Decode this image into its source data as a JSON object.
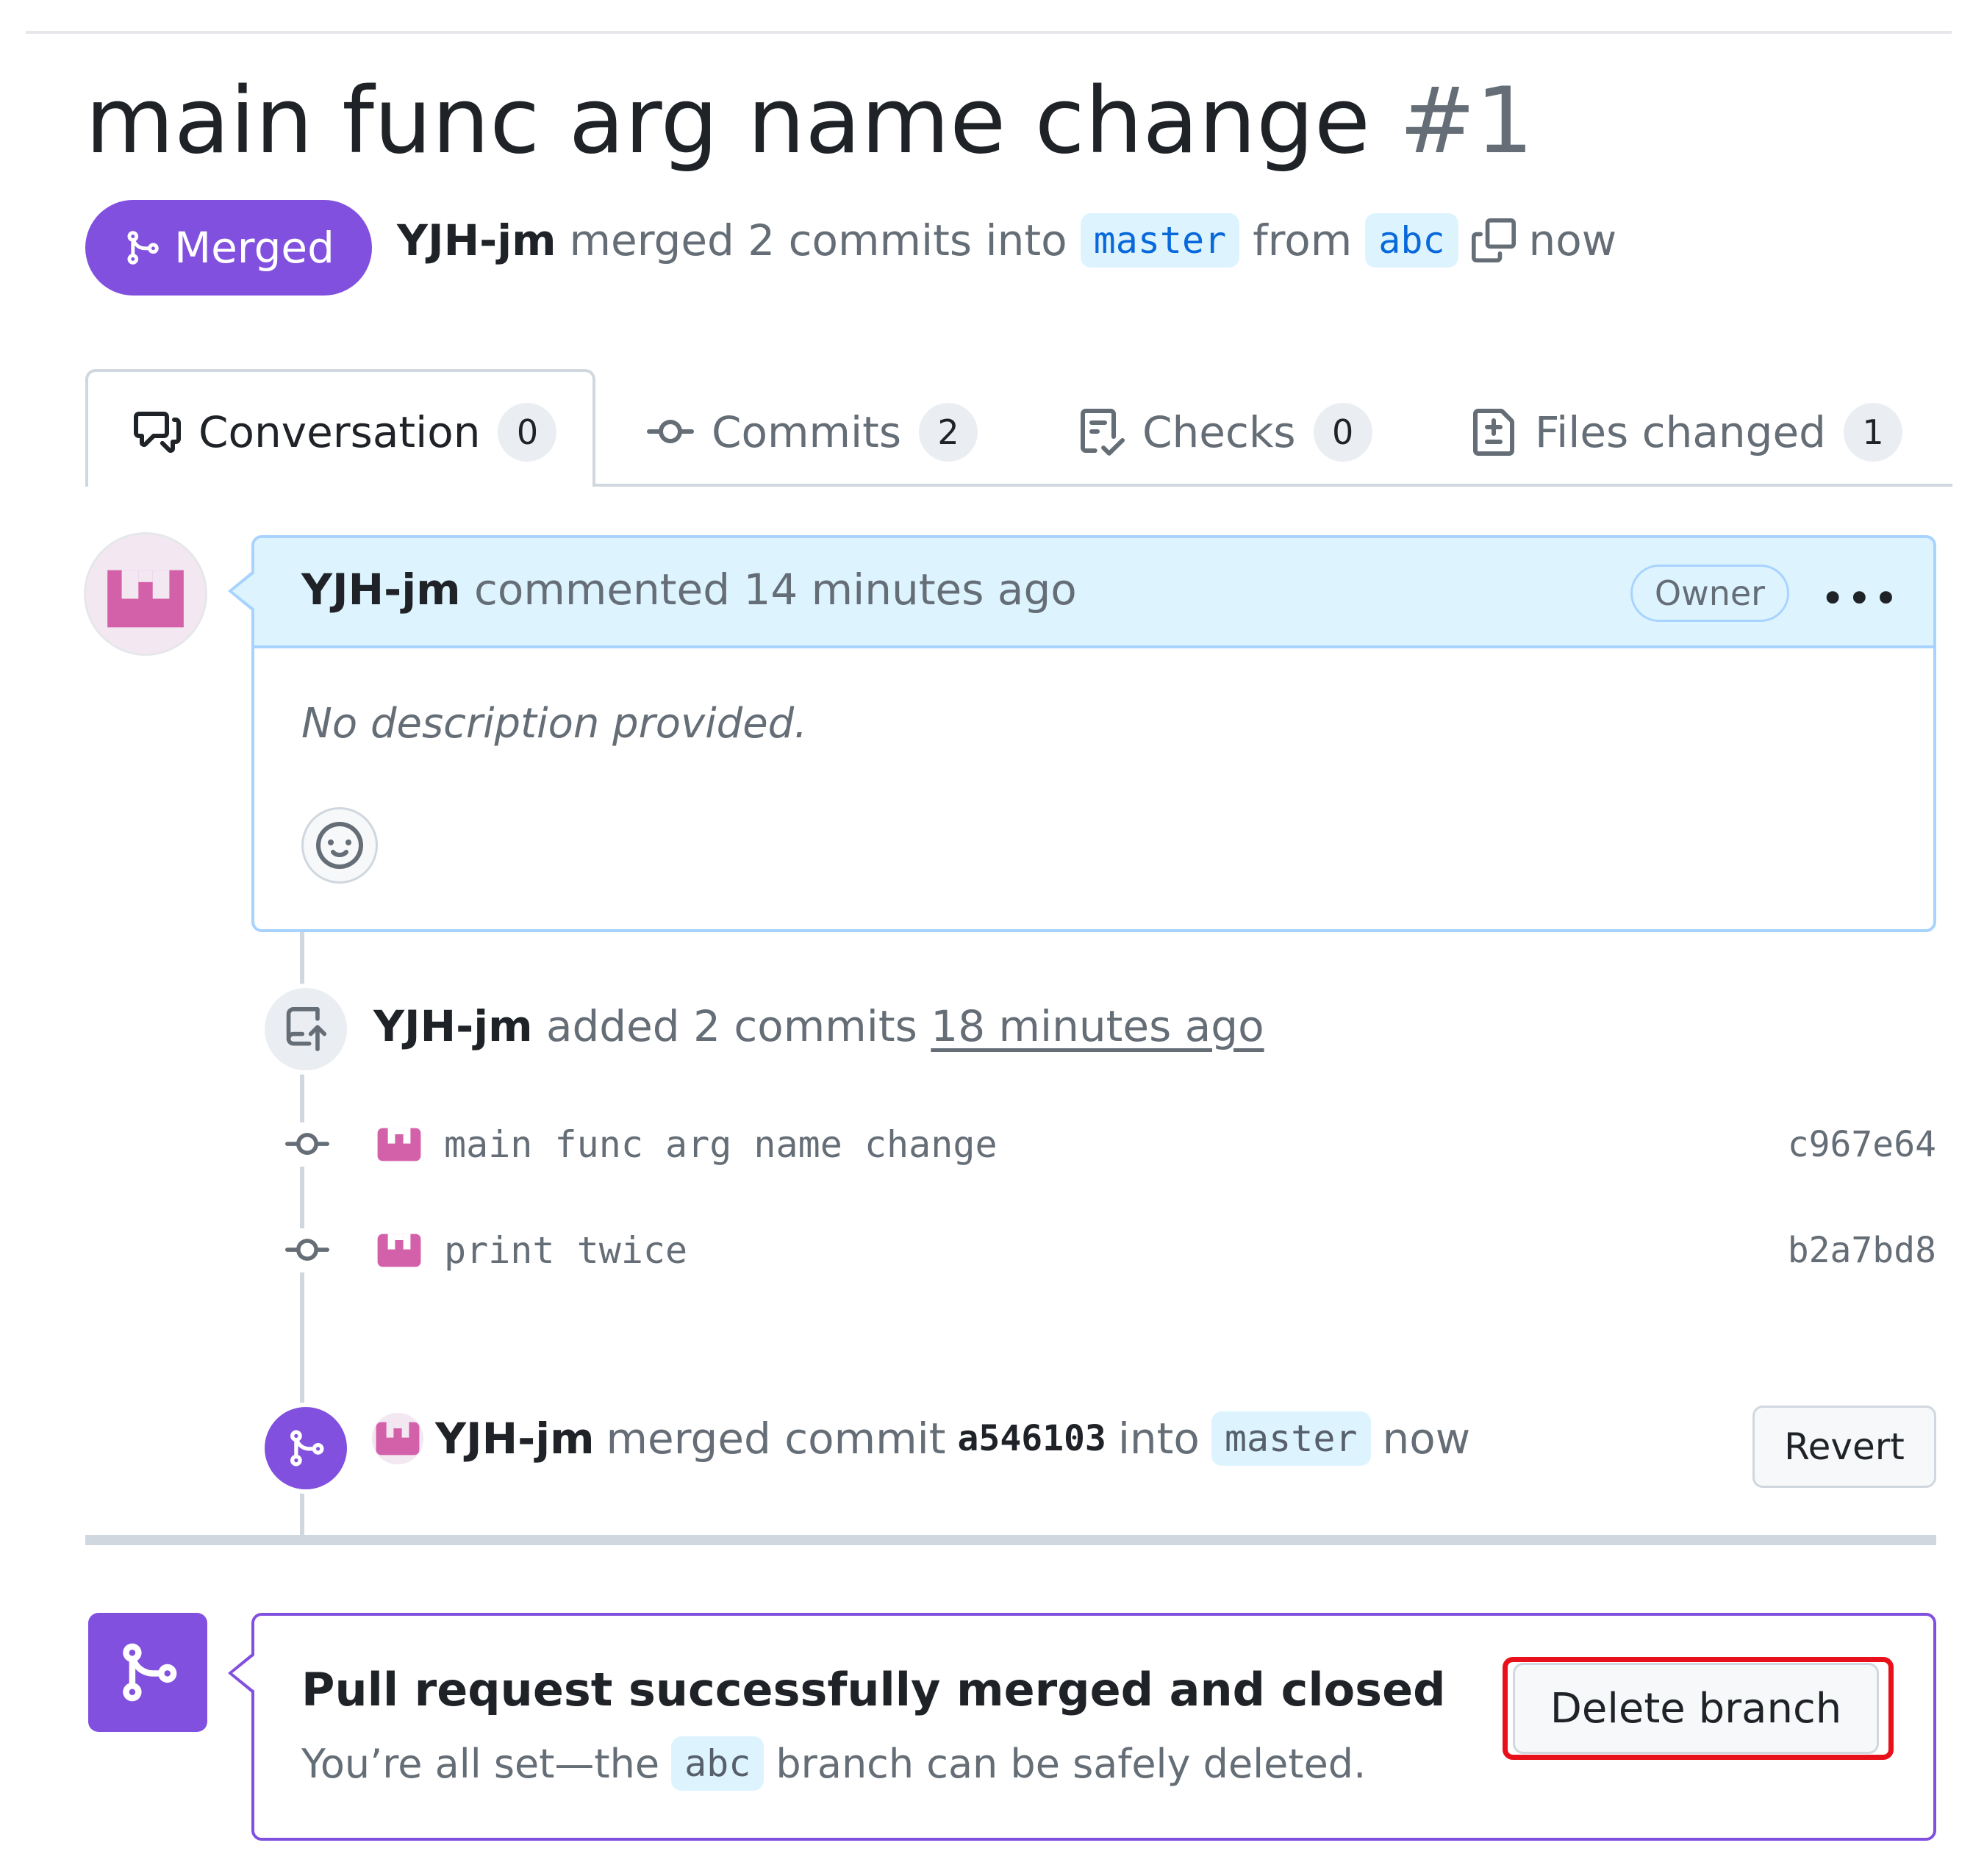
{
  "pr": {
    "title": "main func arg name change",
    "number": "#1",
    "state": "Merged",
    "author": "YJH-jm",
    "action_text": "merged 2 commits into",
    "base_branch": "master",
    "from_text": "from",
    "head_branch": "abc",
    "time": "now"
  },
  "tabs": [
    {
      "label": "Conversation",
      "count": "0",
      "icon": "comment-discussion-icon"
    },
    {
      "label": "Commits",
      "count": "2",
      "icon": "git-commit-icon"
    },
    {
      "label": "Checks",
      "count": "0",
      "icon": "checklist-icon"
    },
    {
      "label": "Files changed",
      "count": "1",
      "icon": "file-diff-icon"
    }
  ],
  "comment": {
    "author": "YJH-jm",
    "action": "commented 14 minutes ago",
    "badge": "Owner",
    "body": "No description provided.",
    "menu": "•••"
  },
  "push_event": {
    "author": "YJH-jm",
    "text": "added 2 commits",
    "time": "18 minutes ago"
  },
  "commits": [
    {
      "message": "main func arg name change",
      "sha": "c967e64"
    },
    {
      "message": "print twice",
      "sha": "b2a7bd8"
    }
  ],
  "merge_event": {
    "author": "YJH-jm",
    "text": "merged commit",
    "sha": "a546103",
    "into": "into",
    "branch": "master",
    "time": "now",
    "revert_label": "Revert"
  },
  "final": {
    "title": "Pull request successfully merged and closed",
    "sub_before": "You’re all set—the",
    "branch": "abc",
    "sub_after": "branch can be safely deleted.",
    "delete_label": "Delete branch"
  },
  "colors": {
    "merged_purple": "#8250df",
    "link_blue": "#0969da",
    "highlight_red": "#e8101a"
  }
}
